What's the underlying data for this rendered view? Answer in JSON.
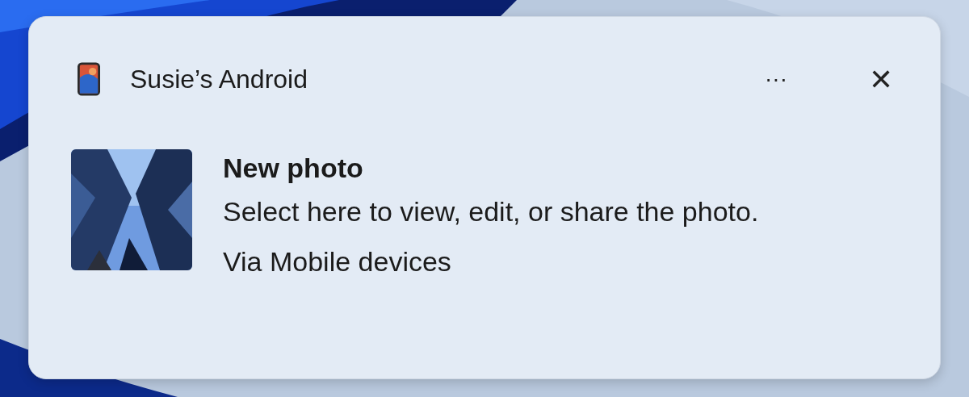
{
  "notification": {
    "app": "Susie’s Android",
    "more_button": "···",
    "close_button": "✕",
    "title": "New photo",
    "body": "Select here to view, edit, or share the photo.",
    "source": "Via Mobile devices"
  }
}
